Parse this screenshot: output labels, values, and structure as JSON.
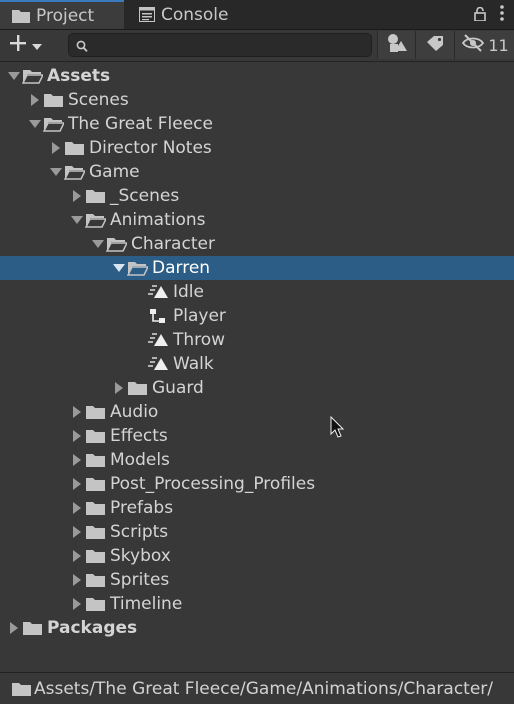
{
  "tabs": [
    {
      "label": "Project",
      "icon": "folder-icon",
      "active": true
    },
    {
      "label": "Console",
      "icon": "console-icon",
      "active": false
    }
  ],
  "tab_icons": [
    "lock-icon",
    "kebab-menu-icon"
  ],
  "toolbar": {
    "add_icon": "plus-icon",
    "search_placeholder": "",
    "search_value": "",
    "filter_type_icon": "shapes-icon",
    "filter_label_icon": "tag-icon",
    "hidden_count": "11"
  },
  "tree": [
    {
      "label": "Assets",
      "depth": 0,
      "type": "folder",
      "state": "expanded",
      "bold": true
    },
    {
      "label": "Scenes",
      "depth": 1,
      "type": "folder",
      "state": "collapsed"
    },
    {
      "label": "The Great Fleece",
      "depth": 1,
      "type": "folder",
      "state": "expanded"
    },
    {
      "label": "Director Notes",
      "depth": 2,
      "type": "folder",
      "state": "collapsed"
    },
    {
      "label": "Game",
      "depth": 2,
      "type": "folder",
      "state": "expanded"
    },
    {
      "label": "_Scenes",
      "depth": 3,
      "type": "folder",
      "state": "collapsed"
    },
    {
      "label": "Animations",
      "depth": 3,
      "type": "folder",
      "state": "expanded"
    },
    {
      "label": "Character",
      "depth": 4,
      "type": "folder",
      "state": "expanded"
    },
    {
      "label": "Darren",
      "depth": 5,
      "type": "folder",
      "state": "expanded",
      "selected": true
    },
    {
      "label": "Idle",
      "depth": 6,
      "type": "anim",
      "state": "leaf"
    },
    {
      "label": "Player",
      "depth": 6,
      "type": "controller",
      "state": "leaf"
    },
    {
      "label": "Throw",
      "depth": 6,
      "type": "anim",
      "state": "leaf"
    },
    {
      "label": "Walk",
      "depth": 6,
      "type": "anim",
      "state": "leaf"
    },
    {
      "label": "Guard",
      "depth": 5,
      "type": "folder",
      "state": "collapsed"
    },
    {
      "label": "Audio",
      "depth": 3,
      "type": "folder",
      "state": "collapsed"
    },
    {
      "label": "Effects",
      "depth": 3,
      "type": "folder",
      "state": "collapsed"
    },
    {
      "label": "Models",
      "depth": 3,
      "type": "folder",
      "state": "collapsed"
    },
    {
      "label": "Post_Processing_Profiles",
      "depth": 3,
      "type": "folder",
      "state": "collapsed"
    },
    {
      "label": "Prefabs",
      "depth": 3,
      "type": "folder",
      "state": "collapsed"
    },
    {
      "label": "Scripts",
      "depth": 3,
      "type": "folder",
      "state": "collapsed"
    },
    {
      "label": "Skybox",
      "depth": 3,
      "type": "folder",
      "state": "collapsed"
    },
    {
      "label": "Sprites",
      "depth": 3,
      "type": "folder",
      "state": "collapsed"
    },
    {
      "label": "Timeline",
      "depth": 3,
      "type": "folder",
      "state": "collapsed"
    },
    {
      "label": "Packages",
      "depth": 0,
      "type": "folder",
      "state": "collapsed",
      "bold": true
    }
  ],
  "status": {
    "path": "Assets/The Great Fleece/Game/Animations/Character/"
  },
  "colors": {
    "selection": "#2c5d87",
    "tab_accent": "#3a79bb",
    "background": "#383838"
  }
}
